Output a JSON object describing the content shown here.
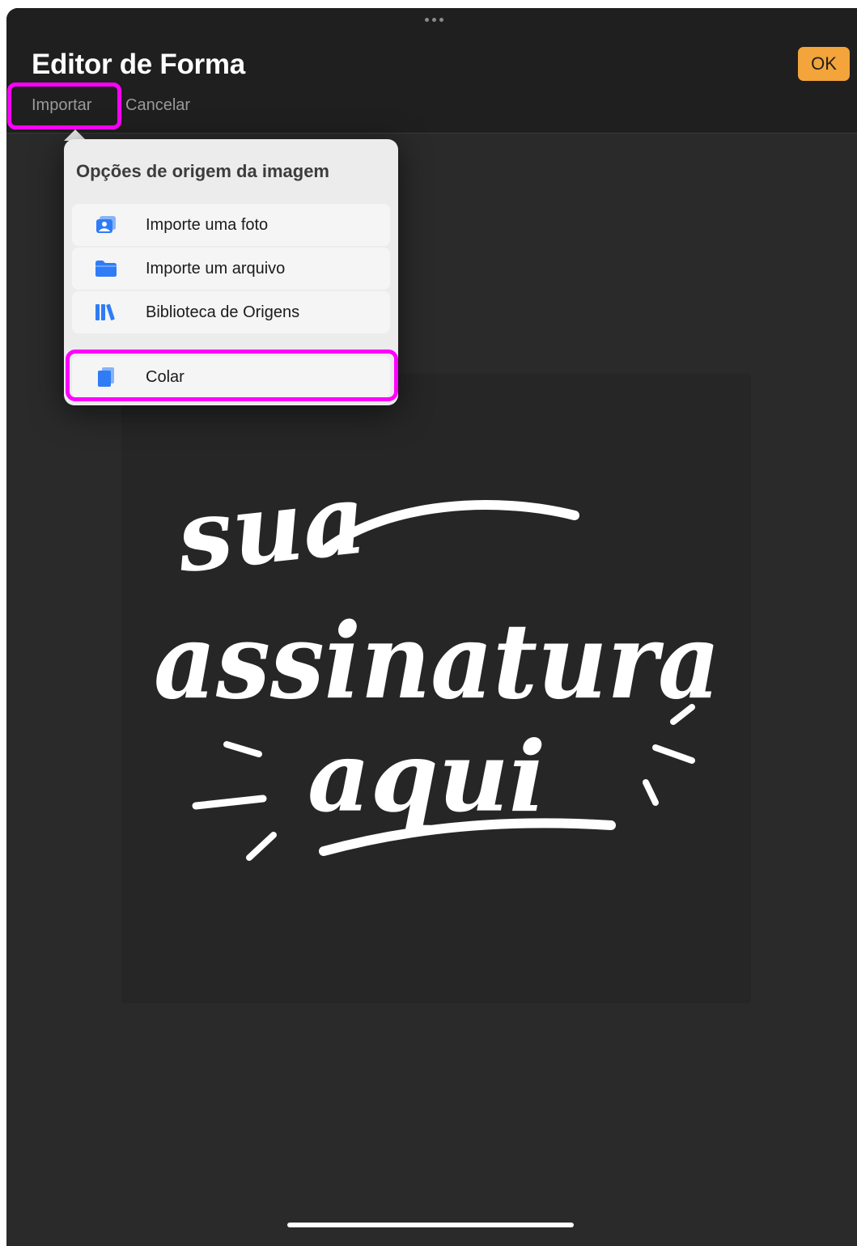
{
  "header": {
    "title": "Editor de Forma",
    "ok_label": "OK",
    "import_label": "Importar",
    "cancel_label": "Cancelar"
  },
  "popover": {
    "title": "Opções de origem da imagem",
    "items": [
      {
        "label": "Importe uma foto",
        "icon": "photo-icon"
      },
      {
        "label": "Importe um arquivo",
        "icon": "folder-icon"
      },
      {
        "label": "Biblioteca de Origens",
        "icon": "library-books-icon"
      },
      {
        "label": "Colar",
        "icon": "paste-clipboard-icon"
      }
    ]
  },
  "canvas": {
    "lines": [
      "sua",
      "assinatura",
      "aqui"
    ]
  },
  "colors": {
    "accent": "#f3a43a",
    "highlight": "#ff00ff",
    "icon_blue": "#2f7cf6",
    "background": "#2a2a2a"
  }
}
